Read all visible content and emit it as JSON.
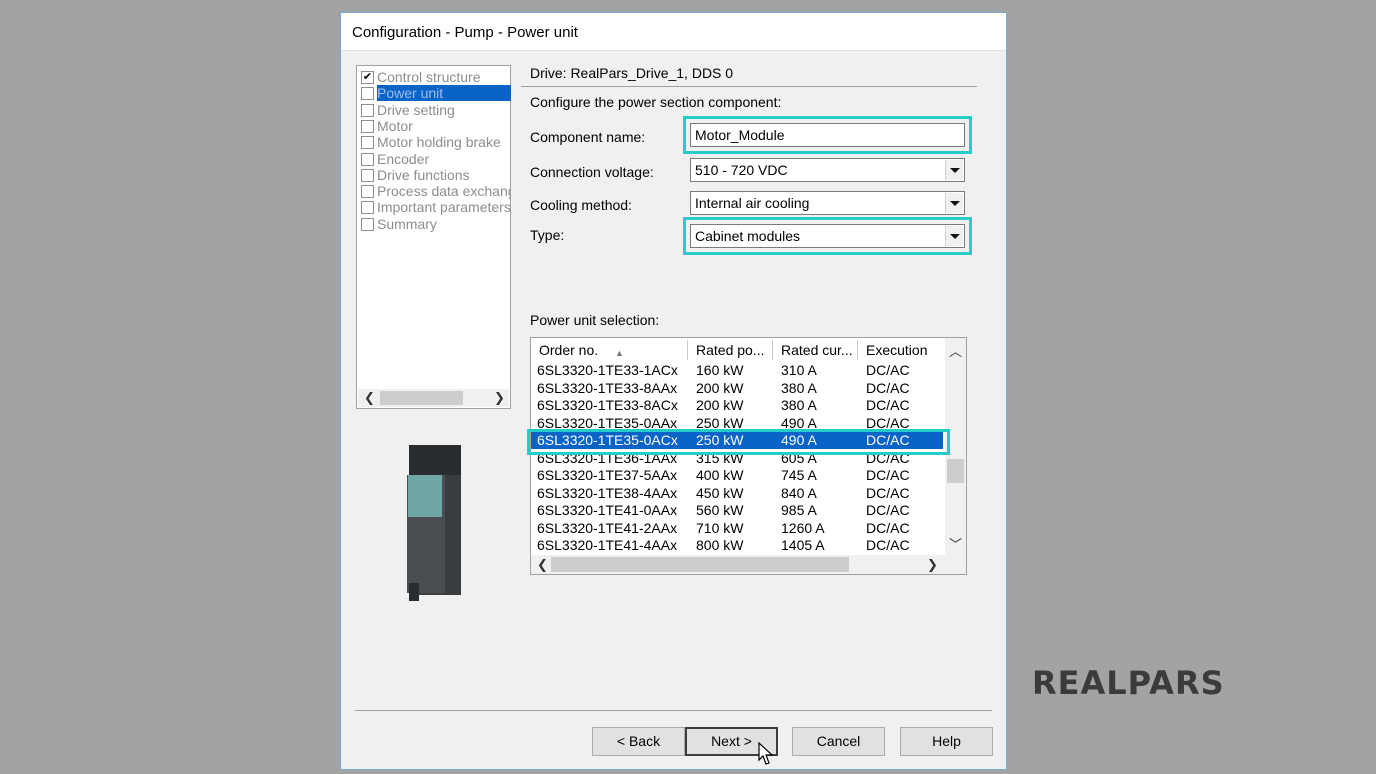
{
  "window": {
    "title": "Configuration - Pump - Power unit"
  },
  "nav": {
    "items": [
      {
        "label": "Control structure",
        "checked": true
      },
      {
        "label": "Power unit",
        "checked": false,
        "selected": true
      },
      {
        "label": "Drive setting",
        "checked": false
      },
      {
        "label": "Motor",
        "checked": false
      },
      {
        "label": "Motor holding brake",
        "checked": false
      },
      {
        "label": "Encoder",
        "checked": false
      },
      {
        "label": "Drive functions",
        "checked": false
      },
      {
        "label": "Process data exchang",
        "checked": false
      },
      {
        "label": "Important parameters",
        "checked": false
      },
      {
        "label": "Summary",
        "checked": false
      }
    ],
    "check_glyph": "✔"
  },
  "header": {
    "drive": "Drive: RealPars_Drive_1, DDS 0",
    "subtitle": "Configure the power section component:"
  },
  "form": {
    "component_name_label": "Component name:",
    "component_name_value": "Motor_Module",
    "connection_voltage_label": "Connection voltage:",
    "connection_voltage_value": "510 - 720 VDC",
    "cooling_method_label": "Cooling method:",
    "cooling_method_value": "Internal air cooling",
    "type_label": "Type:",
    "type_value": "Cabinet modules"
  },
  "power_unit": {
    "label": "Power unit selection:",
    "columns": [
      "Order no.",
      "Rated po...",
      "Rated cur...",
      "Execution"
    ],
    "rows": [
      [
        "6SL3320-1TE33-1ACx",
        "160 kW",
        "310 A",
        "DC/AC"
      ],
      [
        "6SL3320-1TE33-8AAx",
        "200 kW",
        "380 A",
        "DC/AC"
      ],
      [
        "6SL3320-1TE33-8ACx",
        "200 kW",
        "380 A",
        "DC/AC"
      ],
      [
        "6SL3320-1TE35-0AAx",
        "250 kW",
        "490 A",
        "DC/AC"
      ],
      [
        "6SL3320-1TE35-0ACx",
        "250 kW",
        "490 A",
        "DC/AC"
      ],
      [
        "6SL3320-1TE36-1AAx",
        "315 kW",
        "605 A",
        "DC/AC"
      ],
      [
        "6SL3320-1TE37-5AAx",
        "400 kW",
        "745 A",
        "DC/AC"
      ],
      [
        "6SL3320-1TE38-4AAx",
        "450 kW",
        "840 A",
        "DC/AC"
      ],
      [
        "6SL3320-1TE41-0AAx",
        "560 kW",
        "985 A",
        "DC/AC"
      ],
      [
        "6SL3320-1TE41-2AAx",
        "710 kW",
        "1260 A",
        "DC/AC"
      ],
      [
        "6SL3320-1TE41-4AAx",
        "800 kW",
        "1405 A",
        "DC/AC"
      ]
    ],
    "selected_row": 4
  },
  "buttons": {
    "back": "< Back",
    "next": "Next >",
    "cancel": "Cancel",
    "help": "Help"
  },
  "brand": {
    "logo": "REALPARS"
  },
  "colors": {
    "highlight": "#23cdc8",
    "selection": "#0a63c7",
    "backdrop": "#a3a3a3"
  }
}
